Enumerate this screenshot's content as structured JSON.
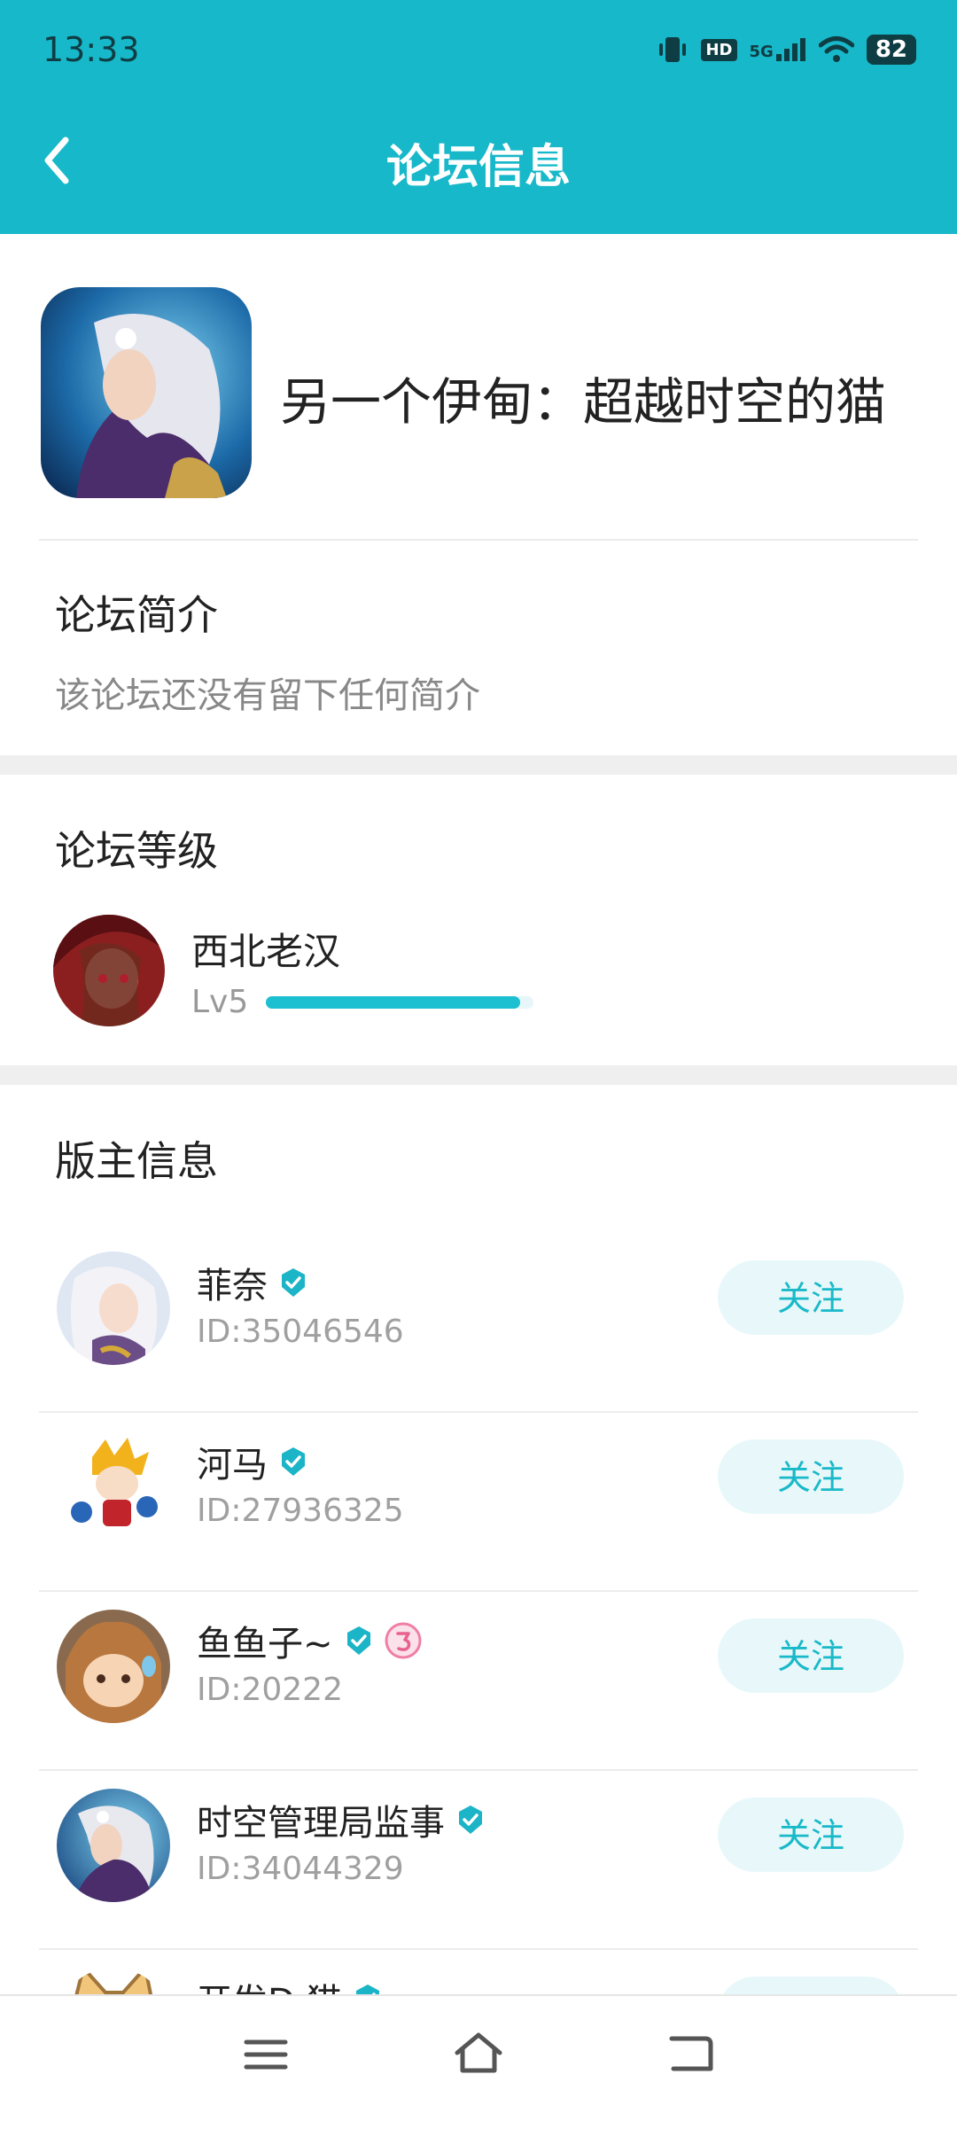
{
  "status": {
    "time": "13:33",
    "battery": "82",
    "hd": "HD",
    "network": "5G"
  },
  "header": {
    "title": "论坛信息"
  },
  "forum": {
    "name": "另一个伊甸：超越时空的猫"
  },
  "intro": {
    "heading": "论坛简介",
    "text": "该论坛还没有留下任何简介"
  },
  "level": {
    "heading": "论坛等级",
    "user": "西北老汉",
    "lv": "Lv5",
    "progress": 0.95
  },
  "moderators": {
    "heading": "版主信息",
    "follow_label": "关注",
    "items": [
      {
        "name": "菲奈",
        "id": "ID:35046546"
      },
      {
        "name": "河马",
        "id": "ID:27936325"
      },
      {
        "name": "鱼鱼子~",
        "id": "ID:20222"
      },
      {
        "name": "时空管理局监事",
        "id": "ID:34044329"
      },
      {
        "name": "开发D·猫"
      }
    ]
  },
  "colors": {
    "accent": "#17b8c9",
    "follow_bg": "#e8f8fa"
  }
}
